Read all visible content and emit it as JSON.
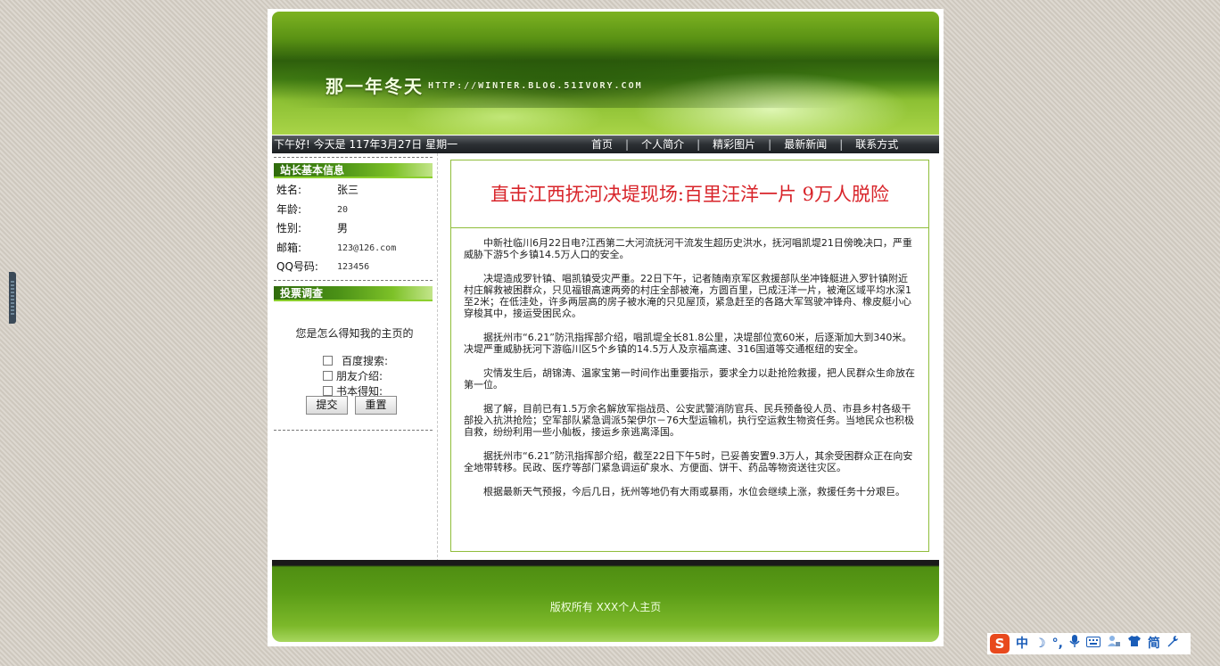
{
  "banner": {
    "logo_text": "那一年冬天",
    "url_text": "HTTP://WINTER.BLOG.51IVORY.COM"
  },
  "topbar": {
    "greeting": "下午好! 今天是 117年3月27日 星期一",
    "nav": [
      {
        "label": "首页"
      },
      {
        "label": "个人简介"
      },
      {
        "label": "精彩图片"
      },
      {
        "label": "最新新闻"
      },
      {
        "label": "联系方式"
      }
    ],
    "separator": "|"
  },
  "sidebar": {
    "info_title": "站长基本信息",
    "info": [
      {
        "key": "姓名:",
        "value": "张三"
      },
      {
        "key": "年龄:",
        "value": "20"
      },
      {
        "key": "性别:",
        "value": "男"
      },
      {
        "key": "邮箱:",
        "value": "123@126.com"
      },
      {
        "key": "QQ号码:",
        "value": "123456"
      }
    ],
    "poll_title": "投票调查",
    "poll_question": "您是怎么得知我的主页的",
    "poll_options": [
      {
        "label": "百度搜索:"
      },
      {
        "label": "朋友介绍:"
      },
      {
        "label": "书本得知:"
      }
    ],
    "submit_label": "提交",
    "reset_label": "重置"
  },
  "article": {
    "title": "直击江西抚河决堤现场:百里汪洋一片 9万人脱险",
    "paragraphs": [
      "中新社临川6月22日电?江西第二大河流抚河干流发生超历史洪水，抚河唱凯堤21日傍晚决口，严重威胁下游5个乡镇14.5万人口的安全。",
      "决堤造成罗针镇、唱凯镇受灾严重。22日下午，记者随南京军区救援部队坐冲锋艇进入罗针镇附近村庄解救被困群众，只见福银高速两旁的村庄全部被淹，方圆百里，已成汪洋一片，被淹区域平均水深1至2米；在低洼处，许多两层高的房子被水淹的只见屋顶，紧急赶至的各路大军驾驶冲锋舟、橡皮艇小心穿梭其中，接运受困民众。",
      "据抚州市“6.21”防汛指挥部介绍，唱凯堤全长81.8公里，决堤部位宽60米，后逐渐加大到340米。决堤严重威胁抚河下游临川区5个乡镇的14.5万人及京福高速、316国道等交通枢纽的安全。",
      "灾情发生后，胡锦涛、温家宝第一时间作出重要指示，要求全力以赴抢险救援，把人民群众生命放在第一位。",
      "据了解，目前已有1.5万余名解放军指战员、公安武警消防官兵、民兵预备役人员、市县乡村各级干部投入抗洪抢险；空军部队紧急调派5架伊尔－76大型运输机，执行空运救生物资任务。当地民众也积极自救，纷纷利用一些小舢板，接运乡亲逃离泽国。",
      "据抚州市“6.21”防汛指挥部介绍，截至22日下午5时，已妥善安置9.3万人，其余受困群众正在向安全地带转移。民政、医疗等部门紧急调运矿泉水、方便面、饼干、药品等物资送往灾区。",
      "根据最新天气预报，今后几日，抚州等地仍有大雨或暴雨，水位会继续上涨，救援任务十分艰巨。"
    ]
  },
  "footer": {
    "copyright": "版权所有 XXX个人主页"
  },
  "ime_toolbar": {
    "logo": "S",
    "mode": "中",
    "width": "简"
  }
}
